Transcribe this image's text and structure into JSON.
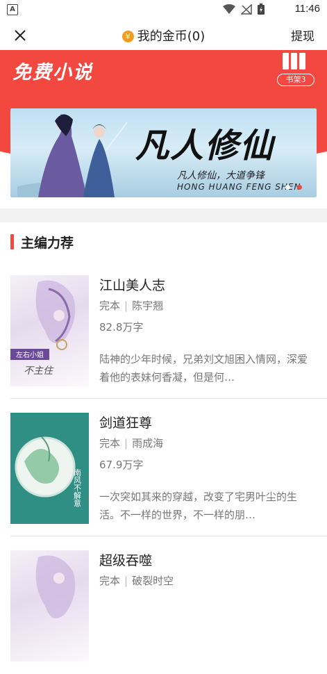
{
  "status": {
    "time": "11:46",
    "app_letter": "A"
  },
  "header": {
    "title": "我的金币(0)",
    "withdraw_label": "提现",
    "coin_symbol": "¥"
  },
  "hero": {
    "brand": "免费小说",
    "shelf_badge": "书架3",
    "banner": {
      "title": "凡人修仙",
      "subtitle": "凡人修仙，大道争锋",
      "pinyin": "HONG HUANG FENG SHEN"
    }
  },
  "section": {
    "title": "主编力荐"
  },
  "books": [
    {
      "title": "江山美人志",
      "status": "完本",
      "author": "陈宇翘",
      "words": "82.8万字",
      "desc": "陆神的少年时候，兄弟刘文旭困入情网，深爱着他的表妹何香凝，但是何…",
      "cover_tag": "左右小姐",
      "cover_text": "不主住"
    },
    {
      "title": "剑道狂尊",
      "status": "完本",
      "author": "雨成海",
      "words": "67.9万字",
      "desc": "一次突如其来的穿越，改变了宅男叶尘的生活。不一样的世界，不一样的朋…",
      "cover_text": "南风不解意"
    },
    {
      "title": "超级吞噬",
      "status": "完本",
      "author": "破裂时空",
      "words": "",
      "desc": ""
    }
  ],
  "colors": {
    "accent": "#f2483f",
    "coin": "#f39c1f"
  }
}
